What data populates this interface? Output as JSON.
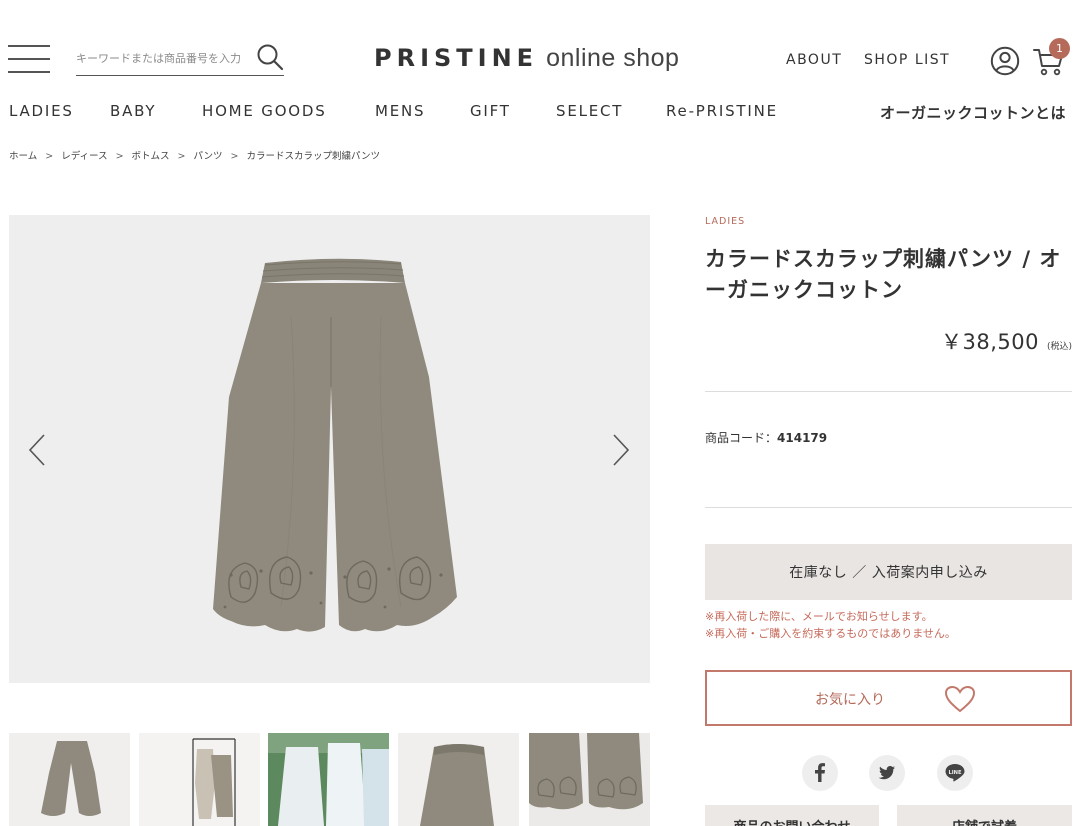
{
  "header": {
    "search_placeholder": "キーワードまたは商品番号を入力",
    "logo_brand": "PRISTINE",
    "logo_sub": "online shop",
    "about": "ABOUT",
    "shop_list": "SHOP LIST",
    "cart_count": "1"
  },
  "nav": {
    "items": [
      "LADIES",
      "BABY",
      "HOME GOODS",
      "MENS",
      "GIFT",
      "SELECT",
      "Re-PRISTINE"
    ],
    "organic": "オーガニックコットンとは"
  },
  "breadcrumb": [
    "ホーム",
    "レディース",
    "ボトムス",
    "パンツ",
    "カラードスカラップ刺繍パンツ"
  ],
  "breadcrumb_sep": ">",
  "product": {
    "category": "LADIES",
    "title": "カラードスカラップ刺繍パンツ / オーガニックコットン",
    "price": "￥38,500",
    "tax_note": "(税込)",
    "code_label": "商品コード：",
    "code_value": "414179",
    "restock_button": "在庫なし ／ 入荷案内申し込み",
    "note_1": "※再入荷した際に、メールでお知らせします。",
    "note_2": "※再入荷・ご購入を約束するものではありません。",
    "favorite_label": "お気に入り",
    "inquiry_button": "商品のお問い合わせ",
    "try_on_button": "店舗で試着"
  },
  "colors": {
    "accent": "#b56a5a",
    "pants": "#8f8a7d",
    "button_bg": "#e8e5e3"
  },
  "icons": {
    "menu": "hamburger-icon",
    "search": "search-icon",
    "account": "account-icon",
    "cart": "cart-icon",
    "favorite": "heart-icon",
    "social": [
      "facebook-icon",
      "twitter-icon",
      "line-icon"
    ],
    "carousel": [
      "chevron-left-icon",
      "chevron-right-icon"
    ]
  }
}
